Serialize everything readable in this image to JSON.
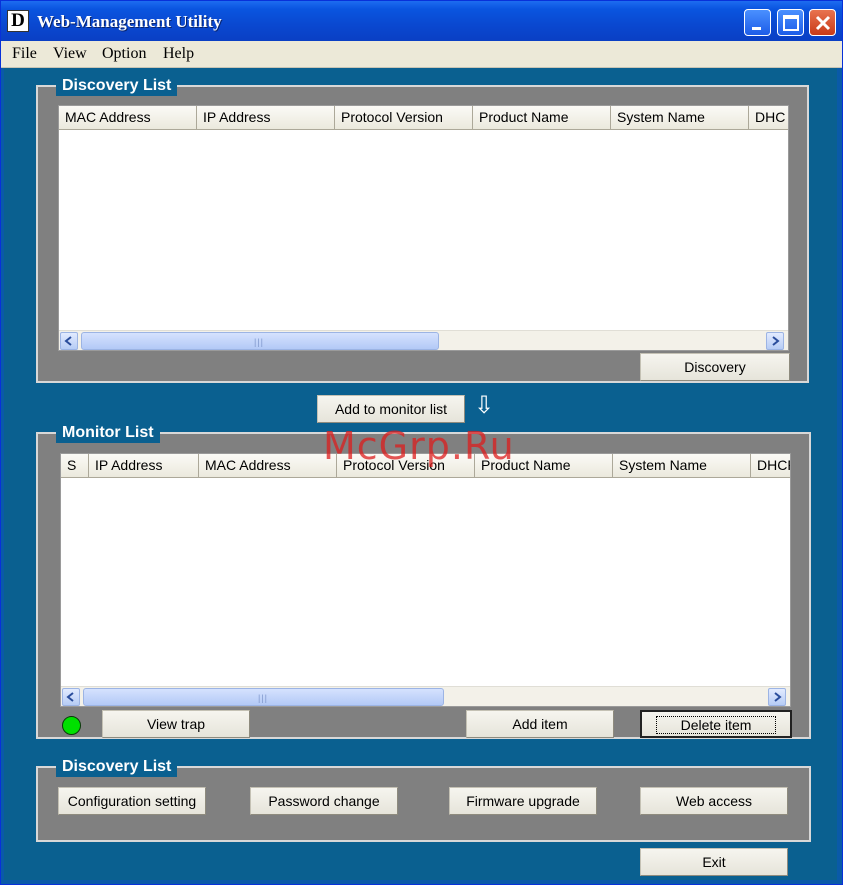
{
  "window": {
    "title": "Web-Management Utility",
    "logo": "D"
  },
  "menu": {
    "items": [
      "File",
      "View",
      "Option",
      "Help"
    ]
  },
  "discovery": {
    "title": "Discovery List",
    "columns": [
      "MAC Address",
      "IP Address",
      "Protocol Version",
      "Product Name",
      "System Name",
      "DHC"
    ],
    "discovery_button": "Discovery"
  },
  "add_monitor": {
    "label": "Add to monitor list",
    "arrow": "⇩"
  },
  "monitor": {
    "title": "Monitor List",
    "columns": [
      "S",
      "IP Address",
      "MAC Address",
      "Protocol Version",
      "Product Name",
      "System Name",
      "DHCP"
    ],
    "view_trap": "View trap",
    "add_item": "Add item",
    "delete_item": "Delete item",
    "status_color": "#00e000"
  },
  "actions": {
    "title": "Discovery List",
    "configuration": "Configuration setting",
    "password": "Password change",
    "firmware": "Firmware upgrade",
    "web_access": "Web access"
  },
  "exit_label": "Exit",
  "watermark": "McGrp.Ru",
  "scroll_grip": "|||"
}
